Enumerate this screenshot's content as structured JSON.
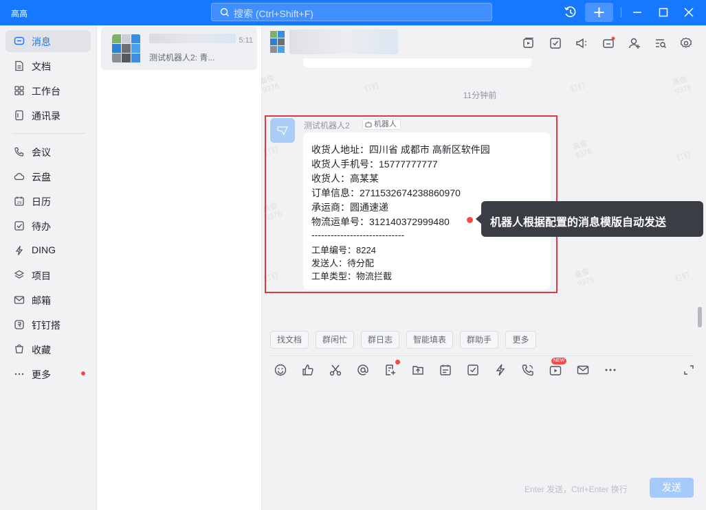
{
  "app": {
    "title": "高高"
  },
  "search": {
    "placeholder": "搜索 (Ctrl+Shift+F)"
  },
  "nav": {
    "items": [
      {
        "label": "消息",
        "icon": "message-icon",
        "active": true
      },
      {
        "label": "文档",
        "icon": "doc-icon"
      },
      {
        "label": "工作台",
        "icon": "grid-icon"
      },
      {
        "label": "通讯录",
        "icon": "contacts-icon"
      },
      {
        "label": "会议",
        "icon": "phone-icon"
      },
      {
        "label": "云盘",
        "icon": "cloud-icon"
      },
      {
        "label": "日历",
        "icon": "calendar-icon"
      },
      {
        "label": "待办",
        "icon": "check-icon"
      },
      {
        "label": "DING",
        "icon": "ding-icon"
      },
      {
        "label": "项目",
        "icon": "project-icon"
      },
      {
        "label": "邮箱",
        "icon": "mail-icon"
      },
      {
        "label": "钉钉搭",
        "icon": "build-icon"
      },
      {
        "label": "收藏",
        "icon": "favorite-icon"
      },
      {
        "label": "更多",
        "icon": "more-icon",
        "badge": true
      }
    ]
  },
  "conversation": {
    "time": "5:11",
    "preview": "测试机器人2: 青..."
  },
  "chat": {
    "time_separator": "11分钟前",
    "watermark": {
      "name": "高俊",
      "id": "9376",
      "brand": "钉钉"
    },
    "message": {
      "sender": "测试机器人2",
      "tag": "机器人",
      "lines": [
        "收货人地址：四川省 成都市 高新区软件园",
        "收货人手机号：15777777777",
        "收货人：高某某",
        "订单信息：2711532674238860970",
        "承运商：圆通速递",
        "物流运单号：312140372999480",
        "-----------------------------",
        "工单编号：8224",
        "发送人：待分配",
        "工单类型：物流拦截"
      ]
    },
    "annotation": "机器人根据配置的消息模版自动发送",
    "quick_actions": [
      "找文档",
      "群闲忙",
      "群日志",
      "智能填表",
      "群助手",
      "更多"
    ],
    "new_badge": "NEW",
    "input_hint": "Enter 发送，Ctrl+Enter 换行",
    "send_label": "发送"
  },
  "colors": {
    "accent": "#1677ff",
    "highlight": "#e0383e",
    "badge": "#f54a45"
  }
}
